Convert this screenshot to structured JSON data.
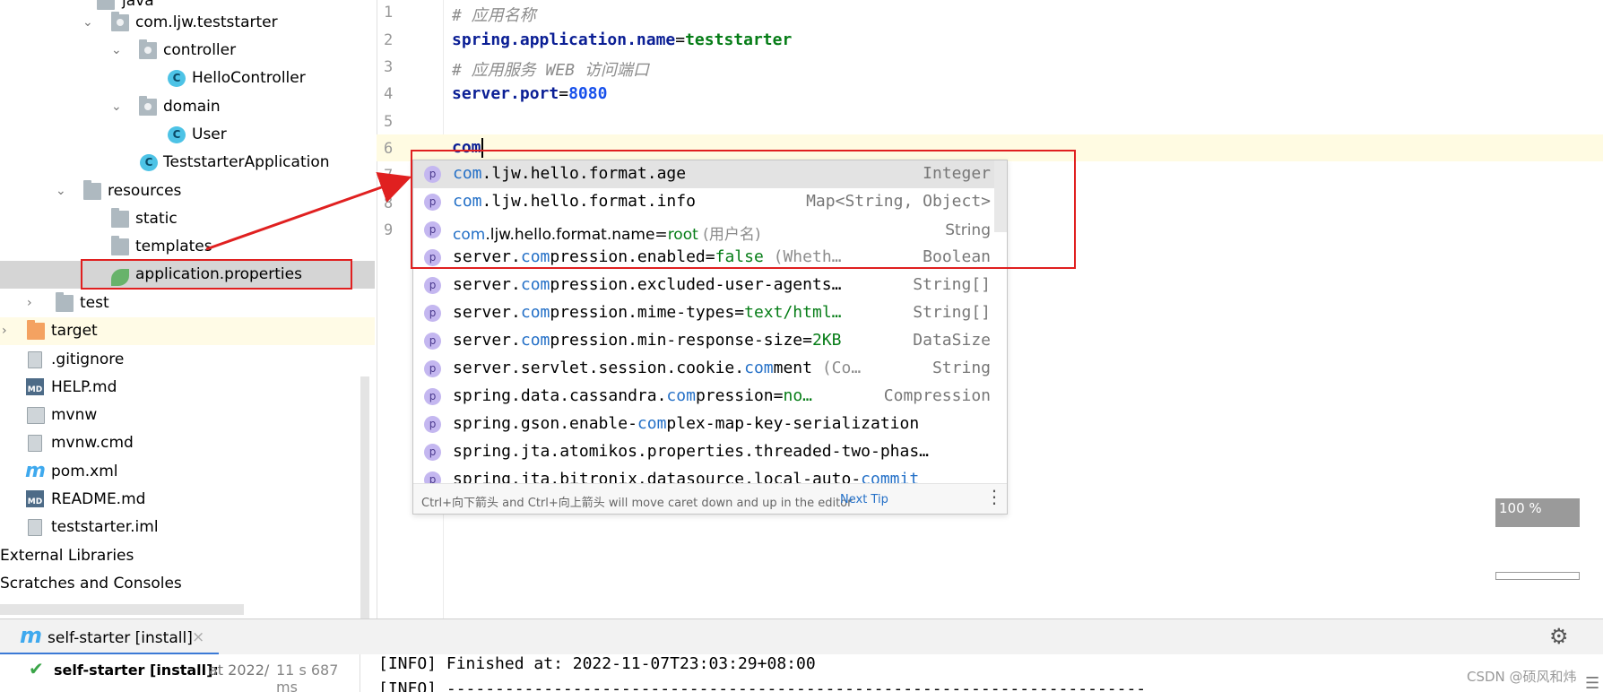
{
  "tree": {
    "items": [
      {
        "label": "java",
        "icon": "folder-icon"
      },
      {
        "label": "com.ljw.teststarter",
        "icon": "package-icon"
      },
      {
        "label": "controller",
        "icon": "package-icon"
      },
      {
        "label": "HelloController",
        "icon": "class-icon"
      },
      {
        "label": "domain",
        "icon": "package-icon"
      },
      {
        "label": "User",
        "icon": "class-icon"
      },
      {
        "label": "TeststarterApplication",
        "icon": "spring-boot-class-icon"
      },
      {
        "label": "resources",
        "icon": "resources-folder-icon"
      },
      {
        "label": "static",
        "icon": "folder-icon"
      },
      {
        "label": "templates",
        "icon": "folder-icon"
      },
      {
        "label": "application.properties",
        "icon": "spring-properties-icon"
      },
      {
        "label": "test",
        "icon": "folder-icon"
      },
      {
        "label": "target",
        "icon": "orange-folder-icon"
      },
      {
        "label": ".gitignore",
        "icon": "ignored-file-icon"
      },
      {
        "label": "HELP.md",
        "icon": "markdown-icon"
      },
      {
        "label": "mvnw",
        "icon": "shell-script-icon"
      },
      {
        "label": "mvnw.cmd",
        "icon": "text-file-icon"
      },
      {
        "label": "pom.xml",
        "icon": "maven-icon"
      },
      {
        "label": "README.md",
        "icon": "markdown-icon"
      },
      {
        "label": "teststarter.iml",
        "icon": "module-file-icon"
      },
      {
        "label": "External Libraries",
        "icon": ""
      },
      {
        "label": "Scratches and Consoles",
        "icon": ""
      }
    ],
    "class_badge": "C",
    "md_badge": "MD",
    "maven_badge": "m"
  },
  "editor": {
    "line_numbers": [
      "1",
      "2",
      "3",
      "4",
      "5",
      "6",
      "7",
      "8",
      "9"
    ],
    "line1": "# 应用名称",
    "line2_key": "spring.application.name",
    "line2_eq": "=",
    "line2_val": "teststarter",
    "line3": "# 应用服务 WEB 访问端口",
    "line4_key": "server.port",
    "line4_eq": "=",
    "line4_val": "8080",
    "line6_typed": "com"
  },
  "completion": {
    "badge": "p",
    "items": [
      {
        "pre": "",
        "match": "com",
        "post": ".ljw.hello.format.age",
        "value": "",
        "desc": "",
        "type": "Integer"
      },
      {
        "pre": "",
        "match": "com",
        "post": ".ljw.hello.format.info",
        "value": "",
        "desc": "",
        "type": "Map<String, Object>"
      },
      {
        "pre": "",
        "match": "com",
        "post": ".ljw.hello.format.name=",
        "value": "root",
        "desc": " (用户名)",
        "type": "String"
      },
      {
        "pre": "server.",
        "match": "com",
        "post": "pression.enabled=",
        "value": "false",
        "desc": " (Wheth…",
        "type": "Boolean"
      },
      {
        "pre": "server.",
        "match": "com",
        "post": "pression.excluded-user-agents…",
        "value": "",
        "desc": "",
        "type": "String[]"
      },
      {
        "pre": "server.",
        "match": "com",
        "post": "pression.mime-types=",
        "value": "text/html…",
        "desc": "",
        "type": "String[]"
      },
      {
        "pre": "server.",
        "match": "com",
        "post": "pression.min-response-size=",
        "value": "2KB",
        "desc": "",
        "type": "DataSize"
      },
      {
        "pre": "server.servlet.session.cookie.",
        "match": "com",
        "post": "ment",
        "value": "",
        "desc": " (Co…",
        "type": "String"
      },
      {
        "pre": "spring.data.cassandra.",
        "match": "com",
        "post": "pression=",
        "value": "no…",
        "desc": "",
        "type": "Compression"
      },
      {
        "pre": "spring.gson.enable-",
        "match": "com",
        "post": "plex-map-key-serialization",
        "value": "",
        "desc": "",
        "type": ""
      },
      {
        "pre": "spring.jta.atomikos.properties.threaded-two-phas…",
        "match": "",
        "post": "",
        "value": "",
        "desc": "",
        "type": ""
      },
      {
        "pre": "spring.jta.bitronix.datasource.local-auto-",
        "match": "commit",
        "post": "",
        "value": "",
        "desc": "",
        "type": ""
      }
    ],
    "footer_tip": "Ctrl+向下箭头 and Ctrl+向上箭头 will move caret down and up in the editor",
    "footer_next": "Next Tip",
    "footer_more": "⋮"
  },
  "zoom": {
    "label": "100 %"
  },
  "run": {
    "tab_icon": "m",
    "tab_label": "self-starter [install]",
    "tab_close": "×",
    "task_name": "self-starter [install]:",
    "task_time": "at 2022/",
    "task_duration": "11 s 687 ms",
    "console_line1": "[INFO] Finished at: 2022-11-07T23:03:29+08:00",
    "console_line2": "[INFO] ------------------------------------------------------------------------"
  },
  "watermark": "CSDN @硕风和炜",
  "colors": {
    "accent": "#3b7ad6",
    "annotation_red": "#e02020",
    "property_key": "#0b1f95",
    "property_value": "#067d17"
  }
}
